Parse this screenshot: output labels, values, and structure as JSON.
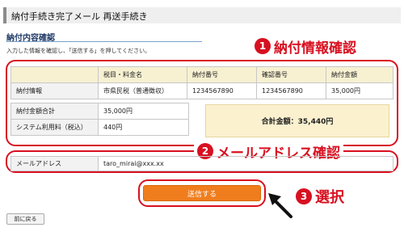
{
  "page": {
    "title": "納付手続き完了メール 再送手続き",
    "section_heading": "納付内容確認",
    "intro_text": "入力した情報を確認し、「送信する」を押してください。"
  },
  "payment_table": {
    "headers": [
      "",
      "税目・料金名",
      "納付番号",
      "確認番号",
      "納付金額"
    ],
    "row": {
      "label": "納付情報",
      "tax_item": "市県民税（普通徴収）",
      "payment_number": "1234567890",
      "confirmation_number": "1234567890",
      "amount": "35,000円"
    }
  },
  "summary": {
    "payment_total_label": "納付金額合計",
    "payment_total_value": "35,000円",
    "fee_label": "システム利用料（税込）",
    "fee_value": "440円",
    "grand_total": "合計金額：35,440円"
  },
  "email": {
    "label": "メールアドレス",
    "value": "taro_mirai@xxx.xx"
  },
  "buttons": {
    "send": "送信する",
    "back": "前に戻る"
  },
  "callouts": {
    "one": {
      "number": "1",
      "text": "納付情報確認"
    },
    "two": {
      "number": "2",
      "text": "メールアドレス確認"
    },
    "three": {
      "number": "3",
      "text": "選択"
    }
  },
  "colors": {
    "accent_red": "#d81020",
    "button_orange": "#f07d1d",
    "header_yellow": "#f7f1d2",
    "total_yellow": "#fbf1cf"
  }
}
